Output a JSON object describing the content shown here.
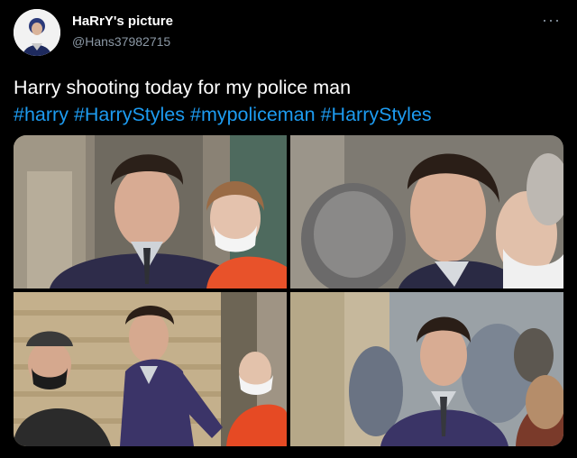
{
  "author": {
    "display_name": "HaRrY's picture",
    "handle": "@Hans37982715",
    "avatar_icon": "profile-avatar"
  },
  "menu": {
    "more_label": "···"
  },
  "tweet": {
    "text": "Harry shooting today for my police man",
    "hashtags": [
      "#harry",
      "#HarryStyles",
      "#mypoliceman",
      "#HarryStyles"
    ]
  },
  "media": {
    "count": 4,
    "items": [
      {
        "desc": "photo-1"
      },
      {
        "desc": "photo-2"
      },
      {
        "desc": "photo-3"
      },
      {
        "desc": "photo-4"
      }
    ]
  },
  "colors": {
    "link": "#1d9bf0",
    "secondary": "#8b98a5",
    "background": "#000000"
  }
}
